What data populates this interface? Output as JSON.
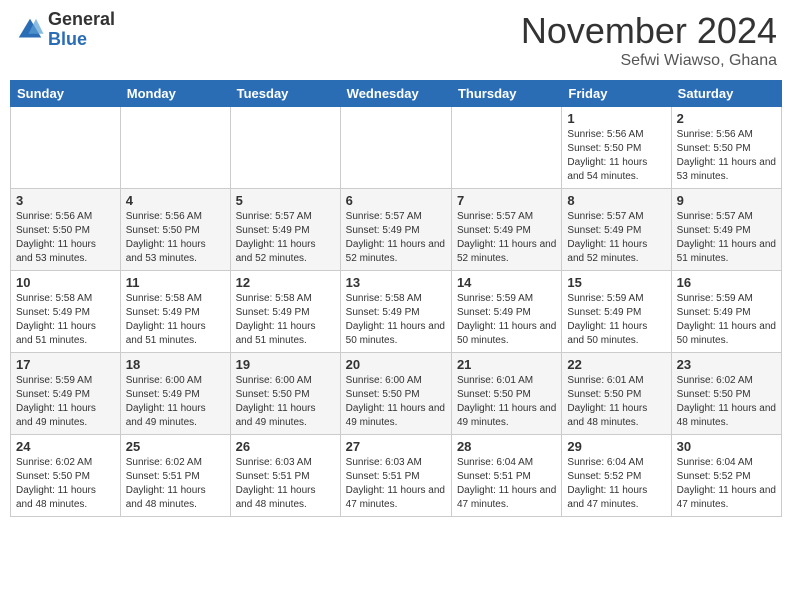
{
  "header": {
    "logo": {
      "general": "General",
      "blue": "Blue"
    },
    "title": "November 2024",
    "location": "Sefwi Wiawso, Ghana"
  },
  "weekdays": [
    "Sunday",
    "Monday",
    "Tuesday",
    "Wednesday",
    "Thursday",
    "Friday",
    "Saturday"
  ],
  "weeks": [
    [
      {
        "day": "",
        "info": ""
      },
      {
        "day": "",
        "info": ""
      },
      {
        "day": "",
        "info": ""
      },
      {
        "day": "",
        "info": ""
      },
      {
        "day": "",
        "info": ""
      },
      {
        "day": "1",
        "info": "Sunrise: 5:56 AM\nSunset: 5:50 PM\nDaylight: 11 hours and 54 minutes."
      },
      {
        "day": "2",
        "info": "Sunrise: 5:56 AM\nSunset: 5:50 PM\nDaylight: 11 hours and 53 minutes."
      }
    ],
    [
      {
        "day": "3",
        "info": "Sunrise: 5:56 AM\nSunset: 5:50 PM\nDaylight: 11 hours and 53 minutes."
      },
      {
        "day": "4",
        "info": "Sunrise: 5:56 AM\nSunset: 5:50 PM\nDaylight: 11 hours and 53 minutes."
      },
      {
        "day": "5",
        "info": "Sunrise: 5:57 AM\nSunset: 5:49 PM\nDaylight: 11 hours and 52 minutes."
      },
      {
        "day": "6",
        "info": "Sunrise: 5:57 AM\nSunset: 5:49 PM\nDaylight: 11 hours and 52 minutes."
      },
      {
        "day": "7",
        "info": "Sunrise: 5:57 AM\nSunset: 5:49 PM\nDaylight: 11 hours and 52 minutes."
      },
      {
        "day": "8",
        "info": "Sunrise: 5:57 AM\nSunset: 5:49 PM\nDaylight: 11 hours and 52 minutes."
      },
      {
        "day": "9",
        "info": "Sunrise: 5:57 AM\nSunset: 5:49 PM\nDaylight: 11 hours and 51 minutes."
      }
    ],
    [
      {
        "day": "10",
        "info": "Sunrise: 5:58 AM\nSunset: 5:49 PM\nDaylight: 11 hours and 51 minutes."
      },
      {
        "day": "11",
        "info": "Sunrise: 5:58 AM\nSunset: 5:49 PM\nDaylight: 11 hours and 51 minutes."
      },
      {
        "day": "12",
        "info": "Sunrise: 5:58 AM\nSunset: 5:49 PM\nDaylight: 11 hours and 51 minutes."
      },
      {
        "day": "13",
        "info": "Sunrise: 5:58 AM\nSunset: 5:49 PM\nDaylight: 11 hours and 50 minutes."
      },
      {
        "day": "14",
        "info": "Sunrise: 5:59 AM\nSunset: 5:49 PM\nDaylight: 11 hours and 50 minutes."
      },
      {
        "day": "15",
        "info": "Sunrise: 5:59 AM\nSunset: 5:49 PM\nDaylight: 11 hours and 50 minutes."
      },
      {
        "day": "16",
        "info": "Sunrise: 5:59 AM\nSunset: 5:49 PM\nDaylight: 11 hours and 50 minutes."
      }
    ],
    [
      {
        "day": "17",
        "info": "Sunrise: 5:59 AM\nSunset: 5:49 PM\nDaylight: 11 hours and 49 minutes."
      },
      {
        "day": "18",
        "info": "Sunrise: 6:00 AM\nSunset: 5:49 PM\nDaylight: 11 hours and 49 minutes."
      },
      {
        "day": "19",
        "info": "Sunrise: 6:00 AM\nSunset: 5:50 PM\nDaylight: 11 hours and 49 minutes."
      },
      {
        "day": "20",
        "info": "Sunrise: 6:00 AM\nSunset: 5:50 PM\nDaylight: 11 hours and 49 minutes."
      },
      {
        "day": "21",
        "info": "Sunrise: 6:01 AM\nSunset: 5:50 PM\nDaylight: 11 hours and 49 minutes."
      },
      {
        "day": "22",
        "info": "Sunrise: 6:01 AM\nSunset: 5:50 PM\nDaylight: 11 hours and 48 minutes."
      },
      {
        "day": "23",
        "info": "Sunrise: 6:02 AM\nSunset: 5:50 PM\nDaylight: 11 hours and 48 minutes."
      }
    ],
    [
      {
        "day": "24",
        "info": "Sunrise: 6:02 AM\nSunset: 5:50 PM\nDaylight: 11 hours and 48 minutes."
      },
      {
        "day": "25",
        "info": "Sunrise: 6:02 AM\nSunset: 5:51 PM\nDaylight: 11 hours and 48 minutes."
      },
      {
        "day": "26",
        "info": "Sunrise: 6:03 AM\nSunset: 5:51 PM\nDaylight: 11 hours and 48 minutes."
      },
      {
        "day": "27",
        "info": "Sunrise: 6:03 AM\nSunset: 5:51 PM\nDaylight: 11 hours and 47 minutes."
      },
      {
        "day": "28",
        "info": "Sunrise: 6:04 AM\nSunset: 5:51 PM\nDaylight: 11 hours and 47 minutes."
      },
      {
        "day": "29",
        "info": "Sunrise: 6:04 AM\nSunset: 5:52 PM\nDaylight: 11 hours and 47 minutes."
      },
      {
        "day": "30",
        "info": "Sunrise: 6:04 AM\nSunset: 5:52 PM\nDaylight: 11 hours and 47 minutes."
      }
    ]
  ]
}
